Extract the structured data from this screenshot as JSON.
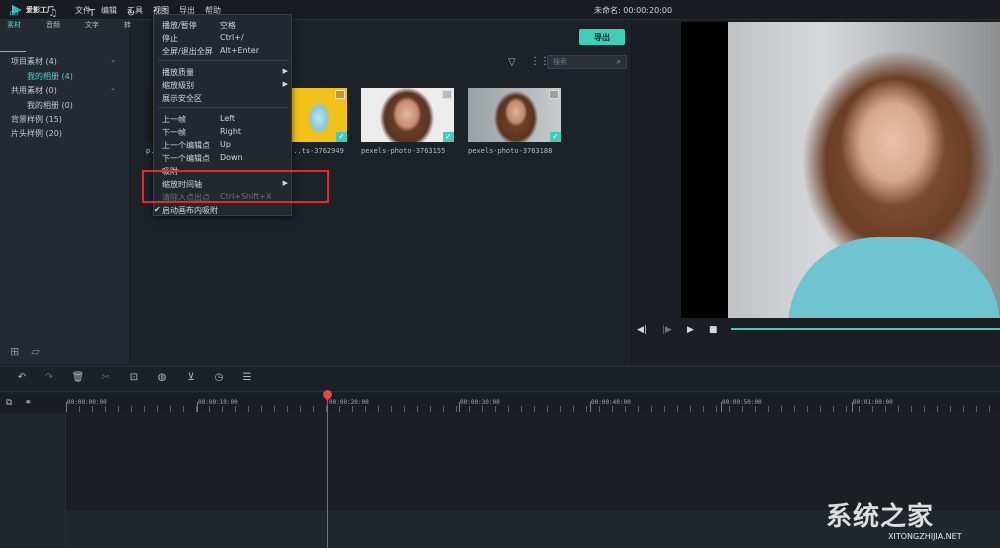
{
  "app": {
    "logo_text": "爱影工厂",
    "project_title": "未命名: 00:00:20:00"
  },
  "menubar": [
    "文件",
    "编辑",
    "工具",
    "视图",
    "导出",
    "帮助"
  ],
  "library": {
    "tabs": [
      {
        "icon": "folder-icon",
        "label": "素材",
        "active": true
      },
      {
        "icon": "music-note-icon",
        "label": "音频",
        "active": false
      },
      {
        "icon": "text-icon",
        "label": "文字",
        "active": false
      },
      {
        "icon": "transition-icon",
        "label": "转场",
        "active": false
      }
    ],
    "tree": [
      {
        "label": "项目素材 (4)",
        "level": 0,
        "expand": true
      },
      {
        "label": "我的相册 (4)",
        "level": 1,
        "active": true
      },
      {
        "label": "共用素材 (0)",
        "level": 0,
        "expand": true
      },
      {
        "label": "我的相册 (0)",
        "level": 1
      },
      {
        "label": "背景样例 (15)",
        "level": 0
      },
      {
        "label": "片头样例 (20)",
        "level": 0
      }
    ]
  },
  "media": {
    "export_label": "导出",
    "search_placeholder": "搜索",
    "items": [
      {
        "label": "p..."
      },
      {
        "label": "...ts-3762949"
      },
      {
        "label": "pexels-photo-3763155"
      },
      {
        "label": "pexels-photo-3763188"
      }
    ]
  },
  "view_menu": [
    {
      "label": "播放/暂停",
      "shortcut": "空格"
    },
    {
      "label": "停止",
      "shortcut": "Ctrl+/"
    },
    {
      "label": "全屏/退出全屏",
      "shortcut": "Alt+Enter"
    },
    {
      "label": "播放质量",
      "shortcut": "",
      "submenu": true
    },
    {
      "label": "缩放级别",
      "shortcut": "",
      "submenu": true
    },
    {
      "label": "展示安全区",
      "shortcut": ""
    },
    {
      "label": "上一帧",
      "shortcut": "Left"
    },
    {
      "label": "下一帧",
      "shortcut": "Right"
    },
    {
      "label": "上一个编辑点",
      "shortcut": "Up"
    },
    {
      "label": "下一个编辑点",
      "shortcut": "Down"
    },
    {
      "label": "吸附",
      "shortcut": ""
    },
    {
      "label": "缩放时间轴",
      "shortcut": "",
      "submenu": true
    },
    {
      "label": "清除入点出点",
      "shortcut": "Ctrl+Shift+X",
      "disabled": true
    },
    {
      "label": "启动画布内吸附",
      "shortcut": "",
      "checked": true
    }
  ],
  "timeline": {
    "time_labels": [
      "00:00:00:00",
      "00:00:10:00",
      "00:00:20:00",
      "00:00:30:00",
      "00:00:40:00",
      "00:00:50:00",
      "00:01:00:00"
    ],
    "playhead_time": "00:00:20:00"
  },
  "watermark": {
    "big": "系统之家",
    "small": "XITONGZHIJIA.NET"
  },
  "colors": {
    "accent": "#3fcfb9",
    "highlight": "#e02b2b",
    "playhead": "#e8443a"
  }
}
